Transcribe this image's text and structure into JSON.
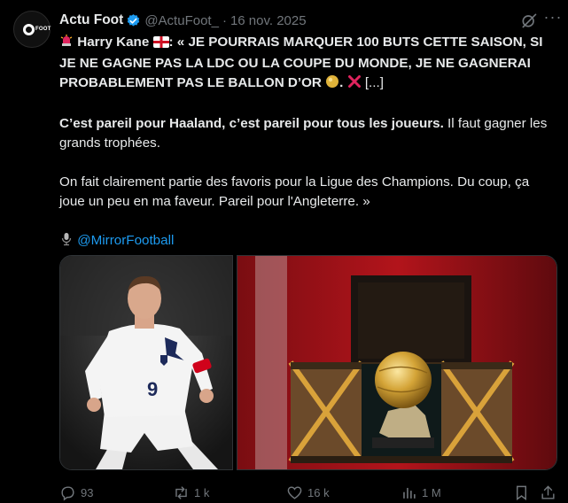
{
  "post": {
    "author_name": "Actu Foot",
    "author_handle": "@ActuFoot_",
    "separator": "·",
    "date": "16 nov. 2025",
    "avatar_text": "FOOT",
    "verified_icon": "verified-badge-icon",
    "lines": {
      "l1_a": "Harry Kane",
      "l1_b": ": « JE POURRAIS MARQUER 100 BUTS CETTE SAISON, SI JE NE GAGNE PAS LA LDC OU LA COUPE DU MONDE, JE NE GAGNERAI PROBABLEMENT PAS LE BALLON D’OR",
      "l1_c": ".",
      "l1_d": "[...]",
      "p2_bold": "C’est pareil pour Haaland, c’est pareil pour tous les joueurs.",
      "p2_rest": " Il faut gagner les grands trophées.",
      "p3": "On fait clairement partie des favoris pour la Ligue des Champions. Du coup, ça joue un peu en ma faveur. Pareil pour l'Angleterre. »",
      "mention": "@MirrorFootball"
    },
    "emojis": [
      "siren-icon",
      "england-flag-icon",
      "golden-ball-icon",
      "cross-mark-icon",
      "microphone-icon"
    ]
  },
  "media": [
    {
      "name": "harry-kane-photo",
      "shirt_number": "9"
    },
    {
      "name": "ballon-dor-trophy-photo"
    }
  ],
  "actions": {
    "replies": "93",
    "reposts": "1 k",
    "likes": "16 k",
    "views": "1 M"
  },
  "colors": {
    "background": "#000000",
    "text": "#e7e9ea",
    "muted": "#71767b",
    "link": "#1d9bf0"
  }
}
